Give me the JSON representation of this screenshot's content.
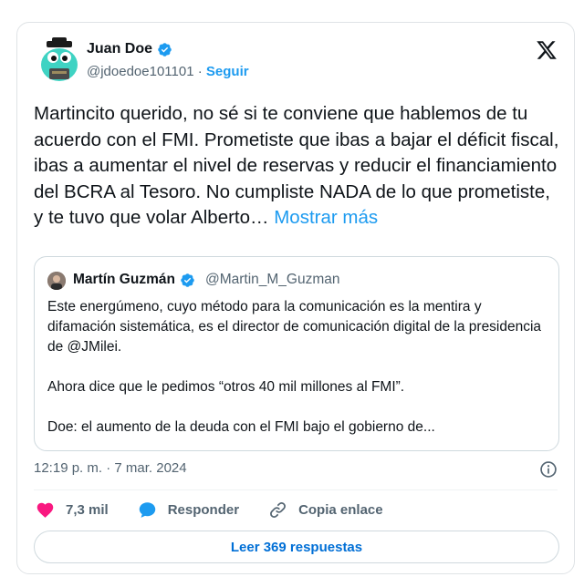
{
  "tweet": {
    "author": {
      "name": "Juan Doe",
      "handle": "@jdoedoe101101",
      "separator": "·",
      "follow_label": "Seguir"
    },
    "text": "Martincito querido, no sé si te conviene que hablemos de tu acuerdo con el FMI. Prometiste que ibas a bajar el déficit fiscal, ibas a aumentar el nivel de reservas y reducir el financiamiento del BCRA al Tesoro. No cumpliste NADA de lo que prometiste, y te tuvo que volar Alberto…",
    "show_more_label": "Mostrar más",
    "quoted": {
      "name": "Martín Guzmán",
      "handle": "@Martin_M_Guzman",
      "paragraphs": [
        "Este energúmeno, cuyo método para la comunicación es la mentira y difamación sistemática, es el director de comunicación digital de la presidencia de @JMilei.",
        "Ahora dice que le pedimos “otros 40 mil millones al FMI”.",
        "Doe: el aumento de la deuda con el FMI bajo el gobierno de..."
      ]
    },
    "timestamp": "12:19 p. m. · 7 mar. 2024",
    "actions": {
      "likes": "7,3 mil",
      "reply_label": "Responder",
      "copy_label": "Copia enlace"
    },
    "read_replies_label": "Leer 369 respuestas"
  },
  "icons": {
    "logo": "x-logo-icon",
    "verified": "verified-badge-icon",
    "info": "info-icon",
    "like": "heart-icon",
    "reply": "speech-bubble-icon",
    "link": "link-icon"
  },
  "colors": {
    "accent": "#1d9bf0",
    "like": "#f91880",
    "muted": "#536471",
    "replies_text": "#006fd6"
  }
}
